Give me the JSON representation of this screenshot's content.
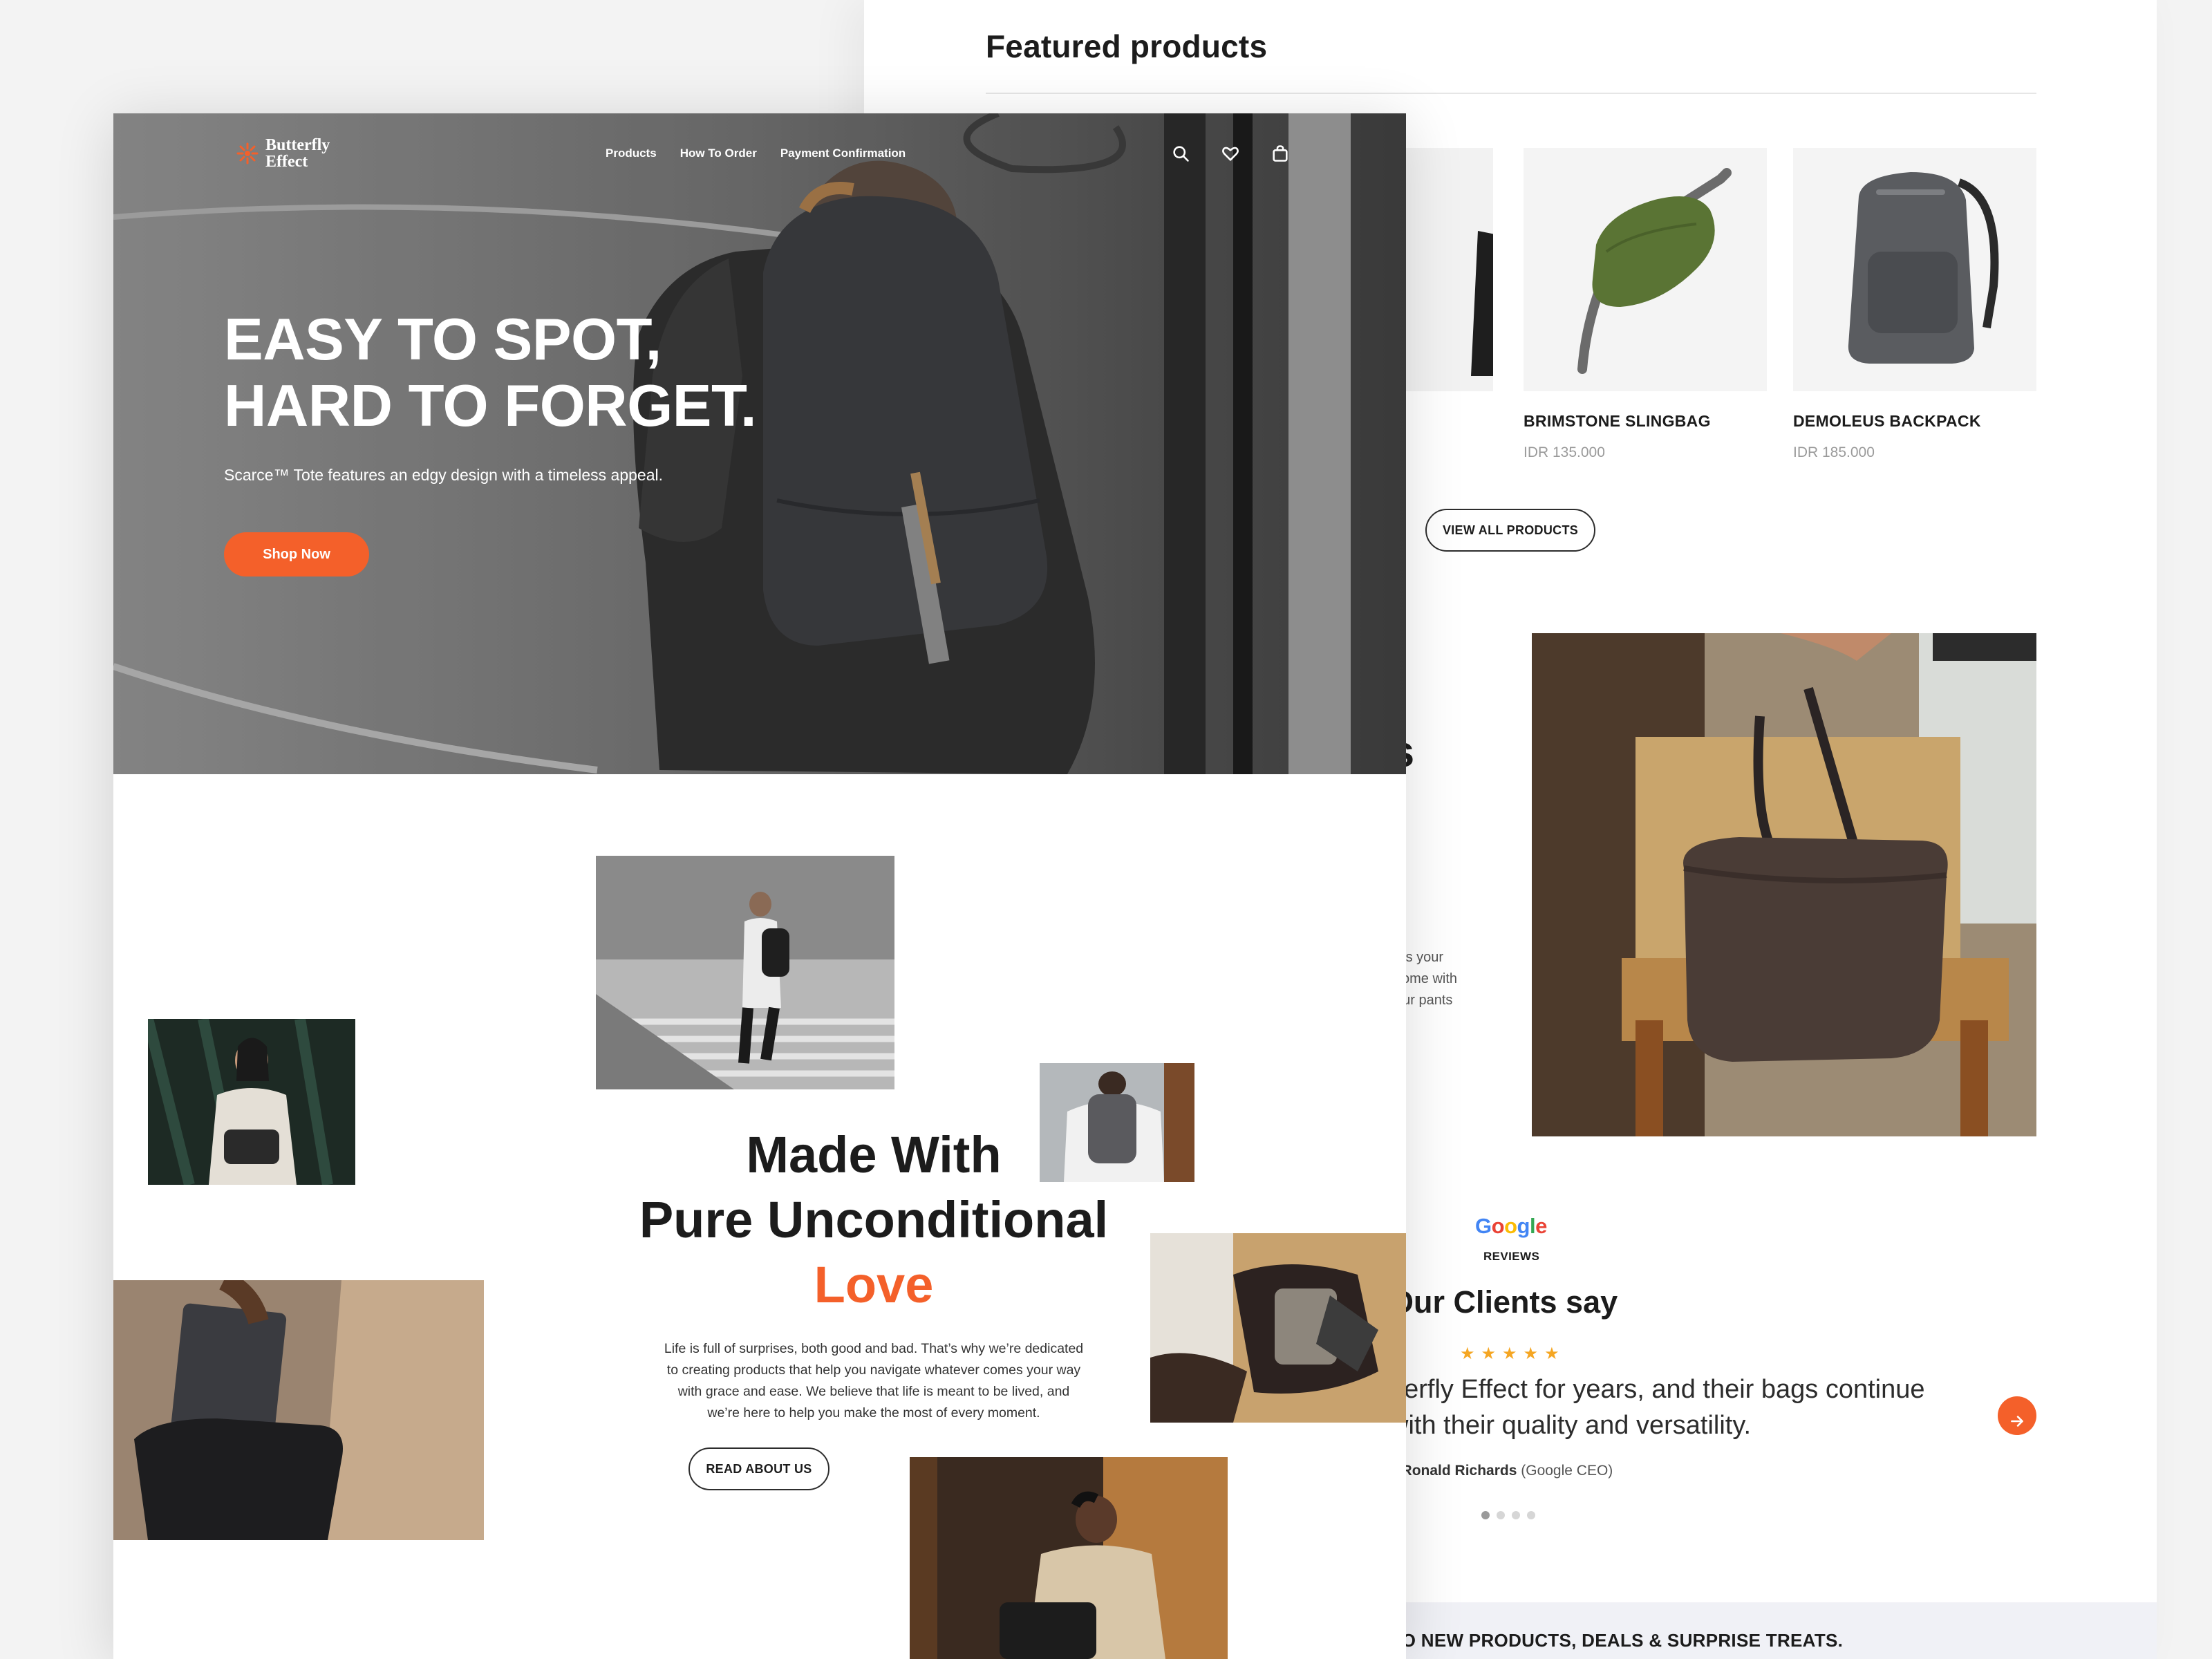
{
  "back_page": {
    "section_title": "Featured products",
    "products": [
      {
        "name": "BRIMSTONE SLINGBAG",
        "price": "IDR 135.000",
        "image_icon": "green-slingbag"
      },
      {
        "name": "DEMOLEUS BACKPACK",
        "price": "IDR 185.000",
        "image_icon": "grey-backpack"
      }
    ],
    "view_all_label": "VIEW ALL PRODUCTS",
    "heading_fragment": "es",
    "paragraph_fragment": "lds your\n come with\nour pants",
    "reviews": {
      "google_label": "Google",
      "reviews_label": "REVIEWS",
      "title": "Our Clients say",
      "stars": "★★★★★",
      "quote": "tterfly Effect for years, and their bags continue\nwith their quality and versatility.",
      "author_name": "Ronald Richards",
      "author_role": "(Google CEO)",
      "author_prefix": "–",
      "next_icon": "arrow-right-icon",
      "dots_count": 4,
      "active_dot": 0
    },
    "newsletter_text": "TO NEW PRODUCTS, DEALS & SURPRISE TREATS."
  },
  "front_page": {
    "brand": "Butterfly\nEffect",
    "nav": [
      "Products",
      "How To Order",
      "Payment Confirmation"
    ],
    "nav_icons": [
      "search-icon",
      "heart-icon",
      "bag-icon"
    ],
    "hero": {
      "title": "EASY TO SPOT,\nHARD TO FORGET.",
      "subtitle": "Scarce™ Tote features an edgy design with a timeless appeal.",
      "cta": "Shop Now"
    },
    "about": {
      "line1": "Made With",
      "line2": "Pure Unconditional",
      "highlight": "Love",
      "body": "Life is full of surprises, both good and bad. That’s why we’re dedicated\nto creating products that help you navigate whatever comes your way\nwith grace and ease. We believe that life is meant to be lived, and\nwe’re here to help you make the most of every moment.",
      "cta": "READ ABOUT US"
    }
  },
  "colors": {
    "accent": "#f4602a",
    "text_dark": "#1c1c1c",
    "muted": "#9a9a9a",
    "star": "#f5a623"
  }
}
